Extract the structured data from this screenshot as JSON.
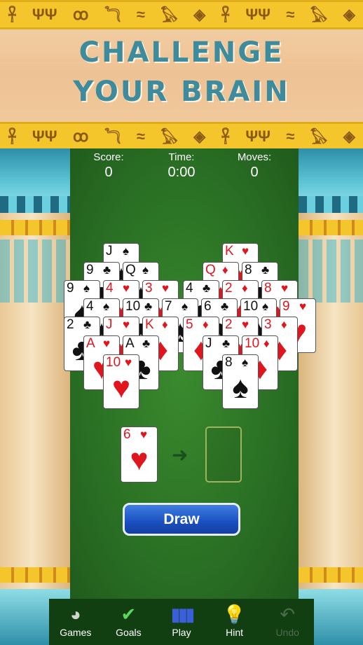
{
  "banner": {
    "headline_line1": "CHALLENGE",
    "headline_line2": "YOUR BRAIN",
    "hieroglyphs": "ꟷ🜲ψ𓅓"
  },
  "hud": {
    "score_label": "Score:",
    "score_value": "0",
    "time_label": "Time:",
    "time_value": "0:00",
    "moves_label": "Moves:",
    "moves_value": "0"
  },
  "cards": {
    "L1": {
      "rank": "J",
      "suit": "♠",
      "color": "black"
    },
    "L2a": {
      "rank": "9",
      "suit": "♣",
      "color": "black"
    },
    "L2b": {
      "rank": "Q",
      "suit": "♠",
      "color": "black"
    },
    "L3a": {
      "rank": "9",
      "suit": "♠",
      "color": "black"
    },
    "L3b": {
      "rank": "4",
      "suit": "♥",
      "color": "red"
    },
    "L3c": {
      "rank": "3",
      "suit": "♥",
      "color": "red"
    },
    "M4a": {
      "rank": "4",
      "suit": "♠",
      "color": "black"
    },
    "M4b": {
      "rank": "10",
      "suit": "♣",
      "color": "black"
    },
    "M4c": {
      "rank": "7",
      "suit": "♠",
      "color": "black"
    },
    "M4d": {
      "rank": "6",
      "suit": "♣",
      "color": "black"
    },
    "M4e": {
      "rank": "10",
      "suit": "♠",
      "color": "black"
    },
    "M4f": {
      "rank": "9",
      "suit": "♥",
      "color": "red"
    },
    "R1": {
      "rank": "K",
      "suit": "♥",
      "color": "red"
    },
    "R2a": {
      "rank": "Q",
      "suit": "♦",
      "color": "red"
    },
    "R2b": {
      "rank": "8",
      "suit": "♣",
      "color": "black"
    },
    "R3a": {
      "rank": "4",
      "suit": "♣",
      "color": "black"
    },
    "R3b": {
      "rank": "2",
      "suit": "♦",
      "color": "red"
    },
    "R3c": {
      "rank": "8",
      "suit": "♥",
      "color": "red"
    },
    "B5a": {
      "rank": "2",
      "suit": "♣",
      "color": "black"
    },
    "B5b": {
      "rank": "J",
      "suit": "♥",
      "color": "red"
    },
    "B5c": {
      "rank": "K",
      "suit": "♦",
      "color": "red"
    },
    "B5d": {
      "rank": "5",
      "suit": "♦",
      "color": "red"
    },
    "B5e": {
      "rank": "2",
      "suit": "♥",
      "color": "red"
    },
    "B5f": {
      "rank": "3",
      "suit": "♦",
      "color": "red"
    },
    "B6a": {
      "rank": "A",
      "suit": "♥",
      "color": "red"
    },
    "B6b": {
      "rank": "A",
      "suit": "♣",
      "color": "black"
    },
    "B6c": {
      "rank": "J",
      "suit": "♣",
      "color": "black"
    },
    "B6d": {
      "rank": "10",
      "suit": "♦",
      "color": "red"
    },
    "B7a": {
      "rank": "10",
      "suit": "♥",
      "color": "red"
    },
    "B7b": {
      "rank": "8",
      "suit": "♠",
      "color": "black"
    },
    "waste": {
      "rank": "6",
      "suit": "♥",
      "color": "red"
    }
  },
  "draw_button": {
    "label": "Draw"
  },
  "nav": [
    {
      "label": "Games",
      "icon": "games-icon",
      "glyph": "◕"
    },
    {
      "label": "Goals",
      "icon": "checkmark-icon",
      "glyph": "✔"
    },
    {
      "label": "Play",
      "icon": "cards-icon",
      "glyph": "▮▮▮"
    },
    {
      "label": "Hint",
      "icon": "lightbulb-icon",
      "glyph": "💡"
    },
    {
      "label": "Undo",
      "icon": "undo-icon",
      "glyph": "↶"
    }
  ],
  "colors": {
    "felt": "#2a7024",
    "accent_teal": "#3d8b9c",
    "draw_blue": "#1a4fc0",
    "red_suit": "#e0161e"
  }
}
